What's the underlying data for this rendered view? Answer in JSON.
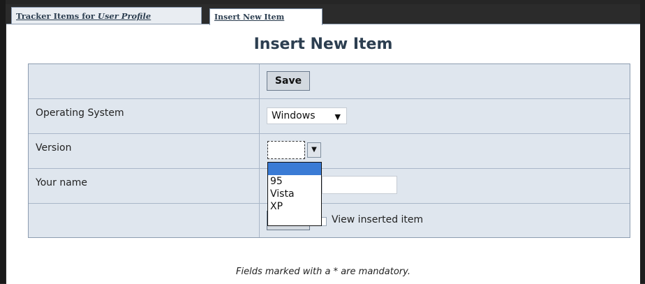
{
  "tabs": [
    {
      "label_main": "Tracker Items for ",
      "label_italic": "User Profile"
    },
    {
      "label": "Insert New Item"
    }
  ],
  "page": {
    "title": "Insert New Item"
  },
  "form": {
    "top_save_label": "Save",
    "rows": [
      {
        "label": "Operating System",
        "value": "Windows"
      },
      {
        "label": "Version",
        "value": ""
      },
      {
        "label": "Your name",
        "value": ""
      }
    ],
    "bottom_save_label": "Save",
    "view_inserted_label": "View inserted item"
  },
  "version_dropdown": {
    "options": [
      "",
      "95",
      "Vista",
      "XP"
    ],
    "selected_index": 0
  },
  "icons": {
    "dropdown_arrow": "▼"
  },
  "footnote": "Fields marked with a * are mandatory."
}
